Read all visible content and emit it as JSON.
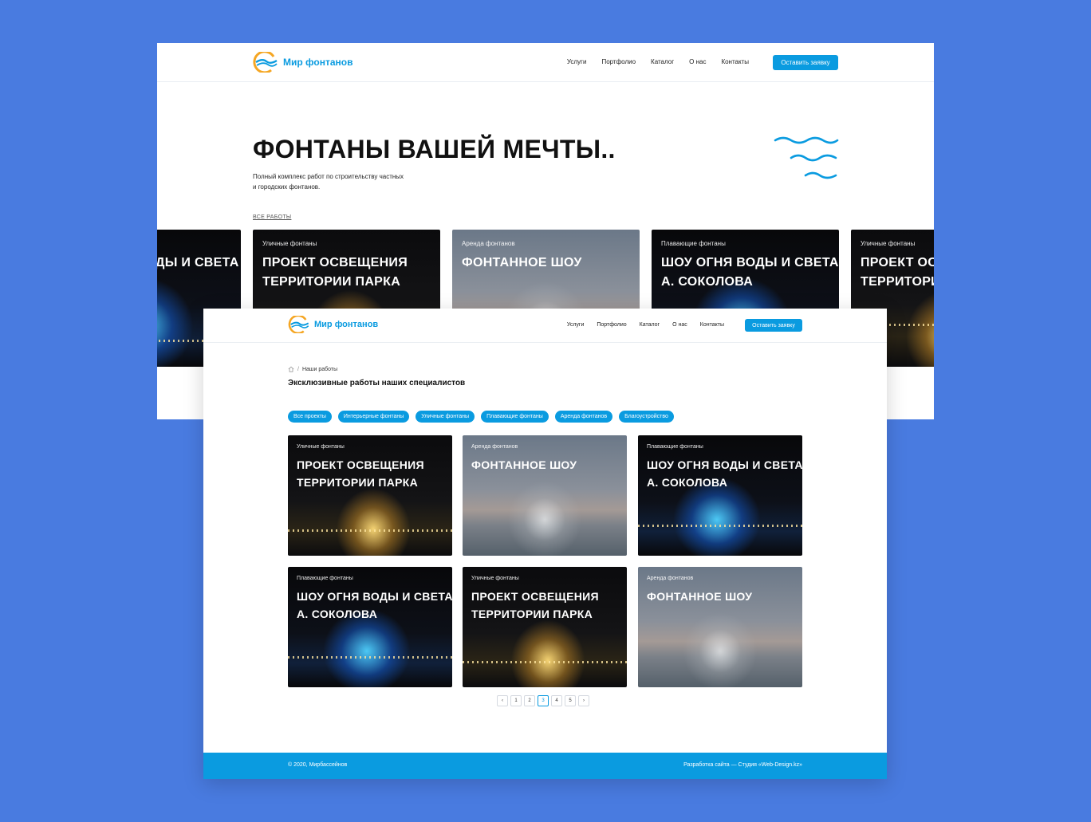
{
  "brand": {
    "name": "Мир фонтанов"
  },
  "nav": [
    "Услуги",
    "Портфолио",
    "Каталог",
    "О нас",
    "Контакты"
  ],
  "cta": "Оставить заявку",
  "hero": {
    "title": "ФОНТАНЫ ВАШЕЙ МЕЧТЫ..",
    "subtitle": "Полный комплекс работ по строительству частных и городских фонтанов.",
    "all_works": "ВСЕ РАБОТЫ"
  },
  "slider": [
    {
      "category": "",
      "title": "ДЫ И СВЕТА"
    },
    {
      "category": "Уличные фонтаны",
      "title1": "ПРОЕКТ ОСВЕЩЕНИЯ",
      "title2": "ТЕРРИТОРИИ ПАРКА"
    },
    {
      "category": "Аренда фонтанов",
      "title1": "ФОНТАННОЕ ШОУ",
      "title2": ""
    },
    {
      "category": "Плавающие фонтаны",
      "title1": "ШОУ ОГНЯ ВОДЫ И СВЕТА",
      "title2": "А. СОКОЛОВА"
    },
    {
      "category": "Уличные фонтаны",
      "title1": "ПРОЕКТ ОСВЕЩЕНИЯ",
      "title2": "ТЕРРИТОРИИ ПАРКА"
    }
  ],
  "breadcrumb": {
    "current": "Наши работы",
    "separator": "/"
  },
  "page_title": "Эксклюзивные работы наших специалистов",
  "filters": [
    "Все проекты",
    "Интерьерные фонтаны",
    "Уличные фонтаны",
    "Плавающие фонтаны",
    "Аренда фонтанов",
    "Благоустройство"
  ],
  "projects": [
    {
      "category": "Уличные фонтаны",
      "title1": "ПРОЕКТ ОСВЕЩЕНИЯ",
      "title2": "ТЕРРИТОРИИ ПАРКА"
    },
    {
      "category": "Аренда фонтанов",
      "title1": "ФОНТАННОЕ ШОУ",
      "title2": ""
    },
    {
      "category": "Плавающие фонтаны",
      "title1": "ШОУ ОГНЯ ВОДЫ И СВЕТА",
      "title2": "А. СОКОЛОВА"
    },
    {
      "category": "Плавающие фонтаны",
      "title1": "ШОУ ОГНЯ ВОДЫ И СВЕТА",
      "title2": "А. СОКОЛОВА"
    },
    {
      "category": "Уличные фонтаны",
      "title1": "ПРОЕКТ ОСВЕЩЕНИЯ",
      "title2": "ТЕРРИТОРИИ ПАРКА"
    },
    {
      "category": "Аренда фонтанов",
      "title1": "ФОНТАННОЕ ШОУ",
      "title2": ""
    }
  ],
  "pagination": {
    "prev_icon": "chevron-left-icon",
    "pages": [
      "1",
      "2",
      "3",
      "4",
      "5"
    ],
    "active": "3",
    "next_icon": "chevron-right-icon"
  },
  "footer": {
    "copyright": "© 2020, Мирбассейнов",
    "developer": "Разработка сайта — Студия «Web-Design.kz»"
  },
  "colors": {
    "background": "#497be0",
    "accent": "#0a9be0",
    "logo_orange": "#f5a623"
  }
}
